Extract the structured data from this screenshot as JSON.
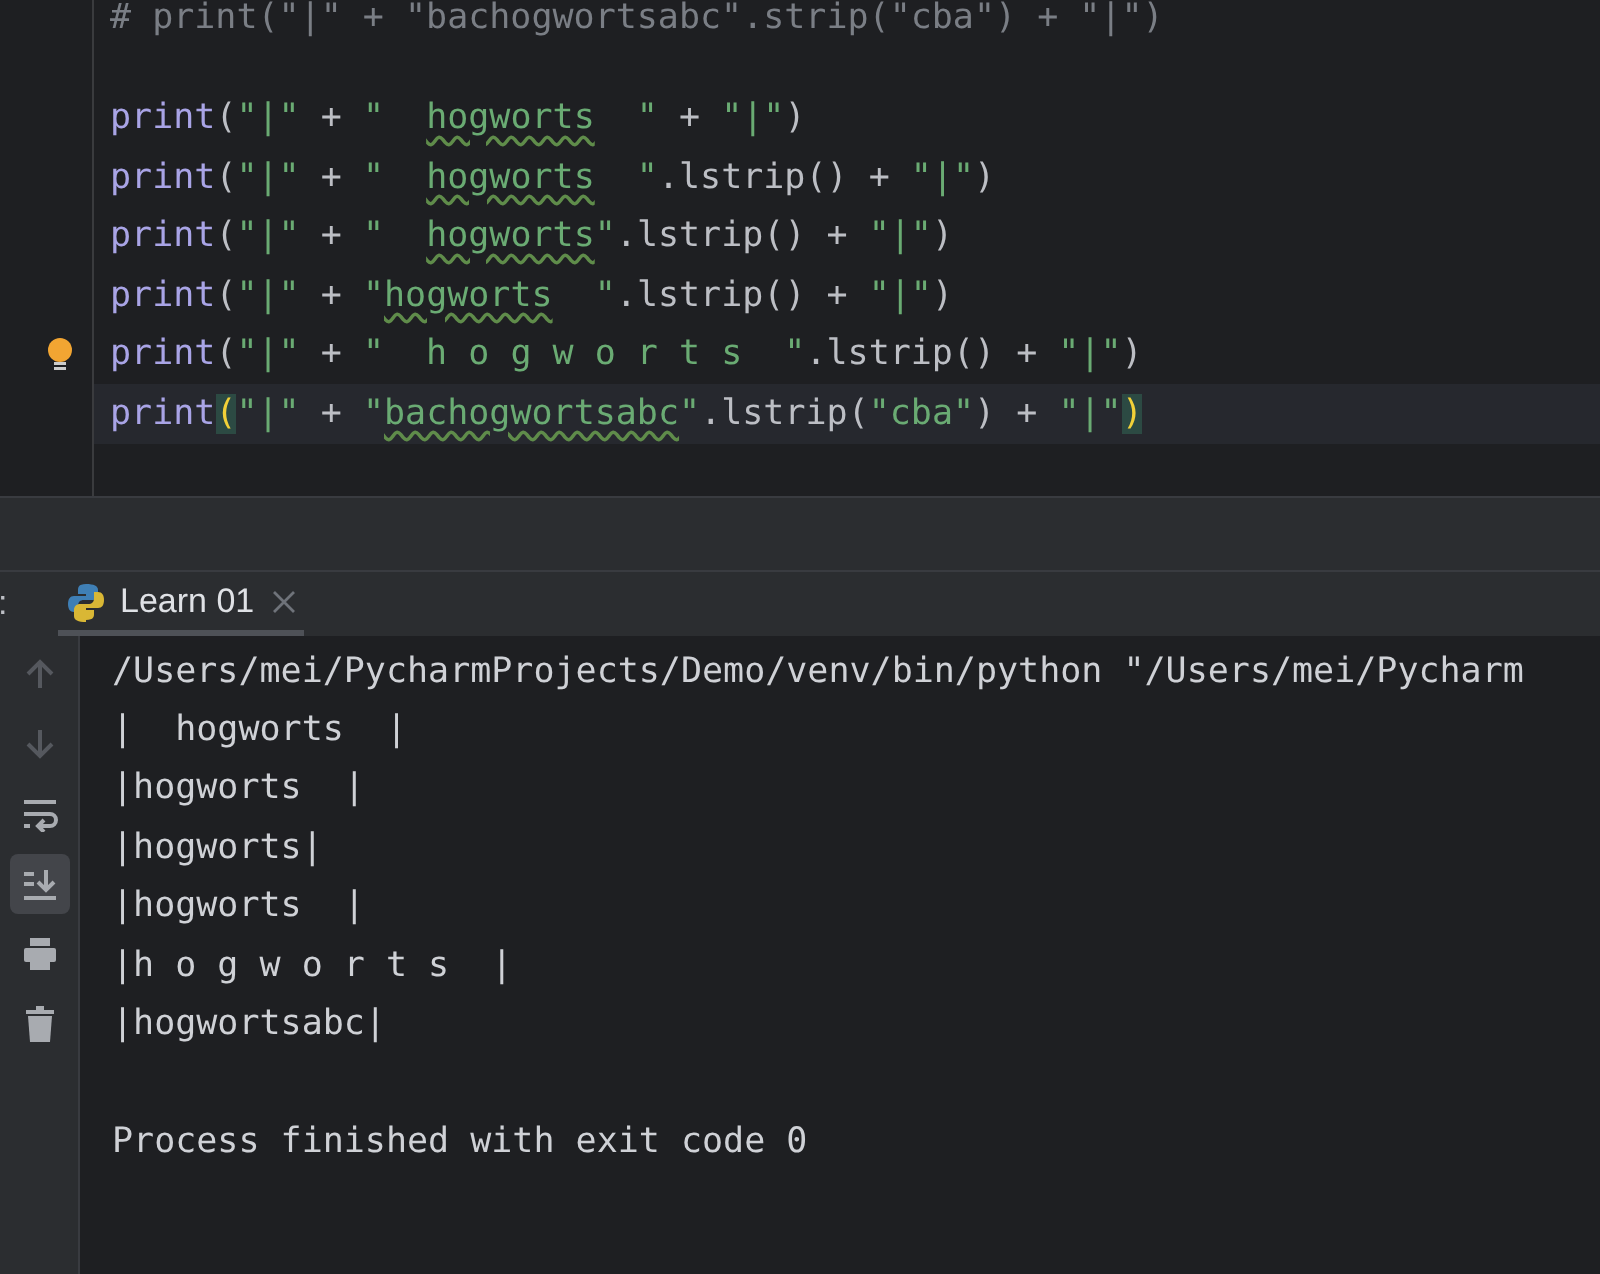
{
  "editor": {
    "lines": [
      {
        "current": false,
        "tokens": [
          {
            "kind": "comment",
            "text": "# print(\"|\" + \"bachogwortsabc\".strip(\"cba\") + \"|\")"
          }
        ]
      },
      {
        "current": false,
        "tokens": [
          {
            "kind": "builtin",
            "text": "print"
          },
          {
            "kind": "plain",
            "text": "("
          },
          {
            "kind": "string",
            "text": "\"|\""
          },
          {
            "kind": "plain",
            "text": " + "
          },
          {
            "kind": "string",
            "text": "\"  "
          },
          {
            "kind": "typo",
            "text": "hogworts"
          },
          {
            "kind": "string",
            "text": "  \""
          },
          {
            "kind": "plain",
            "text": " + "
          },
          {
            "kind": "string",
            "text": "\"|\""
          },
          {
            "kind": "plain",
            "text": ")"
          }
        ]
      },
      {
        "current": false,
        "tokens": [
          {
            "kind": "builtin",
            "text": "print"
          },
          {
            "kind": "plain",
            "text": "("
          },
          {
            "kind": "string",
            "text": "\"|\""
          },
          {
            "kind": "plain",
            "text": " + "
          },
          {
            "kind": "string",
            "text": "\"  "
          },
          {
            "kind": "typo",
            "text": "hogworts"
          },
          {
            "kind": "string",
            "text": "  \""
          },
          {
            "kind": "plain",
            "text": ".lstrip() + "
          },
          {
            "kind": "string",
            "text": "\"|\""
          },
          {
            "kind": "plain",
            "text": ")"
          }
        ]
      },
      {
        "current": false,
        "tokens": [
          {
            "kind": "builtin",
            "text": "print"
          },
          {
            "kind": "plain",
            "text": "("
          },
          {
            "kind": "string",
            "text": "\"|\""
          },
          {
            "kind": "plain",
            "text": " + "
          },
          {
            "kind": "string",
            "text": "\"  "
          },
          {
            "kind": "typo",
            "text": "hogworts"
          },
          {
            "kind": "string",
            "text": "\""
          },
          {
            "kind": "plain",
            "text": ".lstrip() + "
          },
          {
            "kind": "string",
            "text": "\"|\""
          },
          {
            "kind": "plain",
            "text": ")"
          }
        ]
      },
      {
        "current": false,
        "tokens": [
          {
            "kind": "builtin",
            "text": "print"
          },
          {
            "kind": "plain",
            "text": "("
          },
          {
            "kind": "string",
            "text": "\"|\""
          },
          {
            "kind": "plain",
            "text": " + "
          },
          {
            "kind": "string",
            "text": "\""
          },
          {
            "kind": "typo",
            "text": "hogworts"
          },
          {
            "kind": "string",
            "text": "  \""
          },
          {
            "kind": "plain",
            "text": ".lstrip() + "
          },
          {
            "kind": "string",
            "text": "\"|\""
          },
          {
            "kind": "plain",
            "text": ")"
          }
        ]
      },
      {
        "current": false,
        "bulb": true,
        "tokens": [
          {
            "kind": "builtin",
            "text": "print"
          },
          {
            "kind": "plain",
            "text": "("
          },
          {
            "kind": "string",
            "text": "\"|\""
          },
          {
            "kind": "plain",
            "text": " + "
          },
          {
            "kind": "string",
            "text": "\"  h o g w o r t s  \""
          },
          {
            "kind": "plain",
            "text": ".lstrip() + "
          },
          {
            "kind": "string",
            "text": "\"|\""
          },
          {
            "kind": "plain",
            "text": ")"
          }
        ]
      },
      {
        "current": true,
        "tokens": [
          {
            "kind": "builtin",
            "text": "print"
          },
          {
            "kind": "brace",
            "text": "("
          },
          {
            "kind": "string",
            "text": "\"|\""
          },
          {
            "kind": "plain",
            "text": " + "
          },
          {
            "kind": "string",
            "text": "\""
          },
          {
            "kind": "typo",
            "text": "bachogwortsabc"
          },
          {
            "kind": "string",
            "text": "\""
          },
          {
            "kind": "plain",
            "text": ".lstrip("
          },
          {
            "kind": "string",
            "text": "\"cba\""
          },
          {
            "kind": "plain",
            "text": ") + "
          },
          {
            "kind": "string",
            "text": "\"|\""
          },
          {
            "kind": "brace",
            "text": ")"
          }
        ]
      }
    ]
  },
  "run_panel": {
    "side_label": ":",
    "tabs": [
      {
        "label": "Learn 01",
        "selected": true
      }
    ],
    "toolbar": [
      {
        "kind": "up",
        "disabled": true,
        "selected": false
      },
      {
        "kind": "down",
        "disabled": true,
        "selected": false
      },
      {
        "kind": "wrap",
        "disabled": false,
        "selected": false
      },
      {
        "kind": "scroll-end",
        "disabled": false,
        "selected": true
      },
      {
        "kind": "print",
        "disabled": false,
        "selected": false
      },
      {
        "kind": "trash",
        "disabled": false,
        "selected": false
      }
    ],
    "output": [
      "/Users/mei/PycharmProjects/Demo/venv/bin/python \"/Users/mei/Pycharm",
      "|  hogworts  |",
      "|hogworts  |",
      "|hogworts|",
      "|hogworts  |",
      "|h o g w o r t s  |",
      "|hogwortsabc|"
    ],
    "exit_message": "Process finished with exit code 0"
  }
}
